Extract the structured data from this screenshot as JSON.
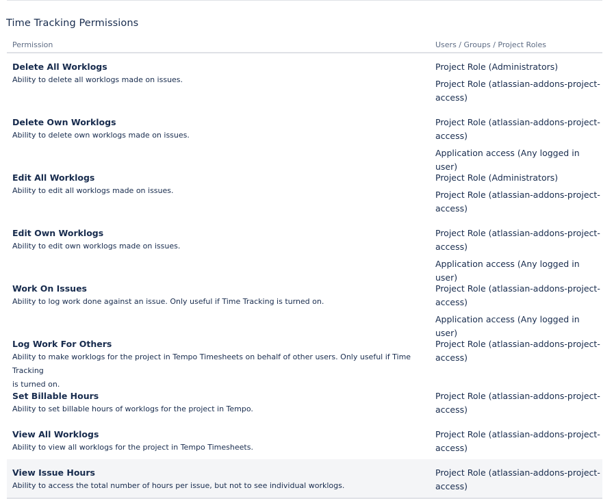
{
  "section": {
    "title": "Time Tracking Permissions"
  },
  "table": {
    "headers": {
      "permission": "Permission",
      "grantees": "Users / Groups / Project Roles"
    },
    "rows": [
      {
        "name": "Delete All Worklogs",
        "description": "Ability to delete all worklogs made on issues.",
        "grants": [
          "Project Role (Administrators)",
          "Project Role (atlassian-addons-project-\naccess)"
        ]
      },
      {
        "name": "Delete Own Worklogs",
        "description": "Ability to delete own worklogs made on issues.",
        "grants": [
          "Project Role (atlassian-addons-project-\naccess)",
          "Application access (Any logged in user)"
        ]
      },
      {
        "name": "Edit All Worklogs",
        "description": "Ability to edit all worklogs made on issues.",
        "grants": [
          "Project Role (Administrators)",
          "Project Role (atlassian-addons-project-\naccess)"
        ]
      },
      {
        "name": "Edit Own Worklogs",
        "description": "Ability to edit own worklogs made on issues.",
        "grants": [
          "Project Role (atlassian-addons-project-\naccess)",
          "Application access (Any logged in user)"
        ]
      },
      {
        "name": "Work On Issues",
        "description": "Ability to log work done against an issue. Only useful if Time Tracking is turned on.",
        "grants": [
          "Project Role (atlassian-addons-project-\naccess)",
          "Application access (Any logged in user)"
        ]
      },
      {
        "name": "Log Work For Others",
        "description": "Ability to make worklogs for the project in Tempo Timesheets on behalf of other users. Only useful if Time Tracking\nis turned on.",
        "grants": [
          "Project Role (atlassian-addons-project-\naccess)"
        ]
      },
      {
        "name": "Set Billable Hours",
        "description": "Ability to set billable hours of worklogs for the project in Tempo.",
        "grants": [
          "Project Role (atlassian-addons-project-\naccess)"
        ]
      },
      {
        "name": "View All Worklogs",
        "description": "Ability to view all worklogs for the project in Tempo Timesheets.",
        "grants": [
          "Project Role (atlassian-addons-project-\naccess)"
        ]
      },
      {
        "name": "View Issue Hours",
        "description": "Ability to access the total number of hours per issue, but not to see individual worklogs.",
        "grants": [
          "Project Role (atlassian-addons-project-\naccess)"
        ]
      }
    ]
  }
}
